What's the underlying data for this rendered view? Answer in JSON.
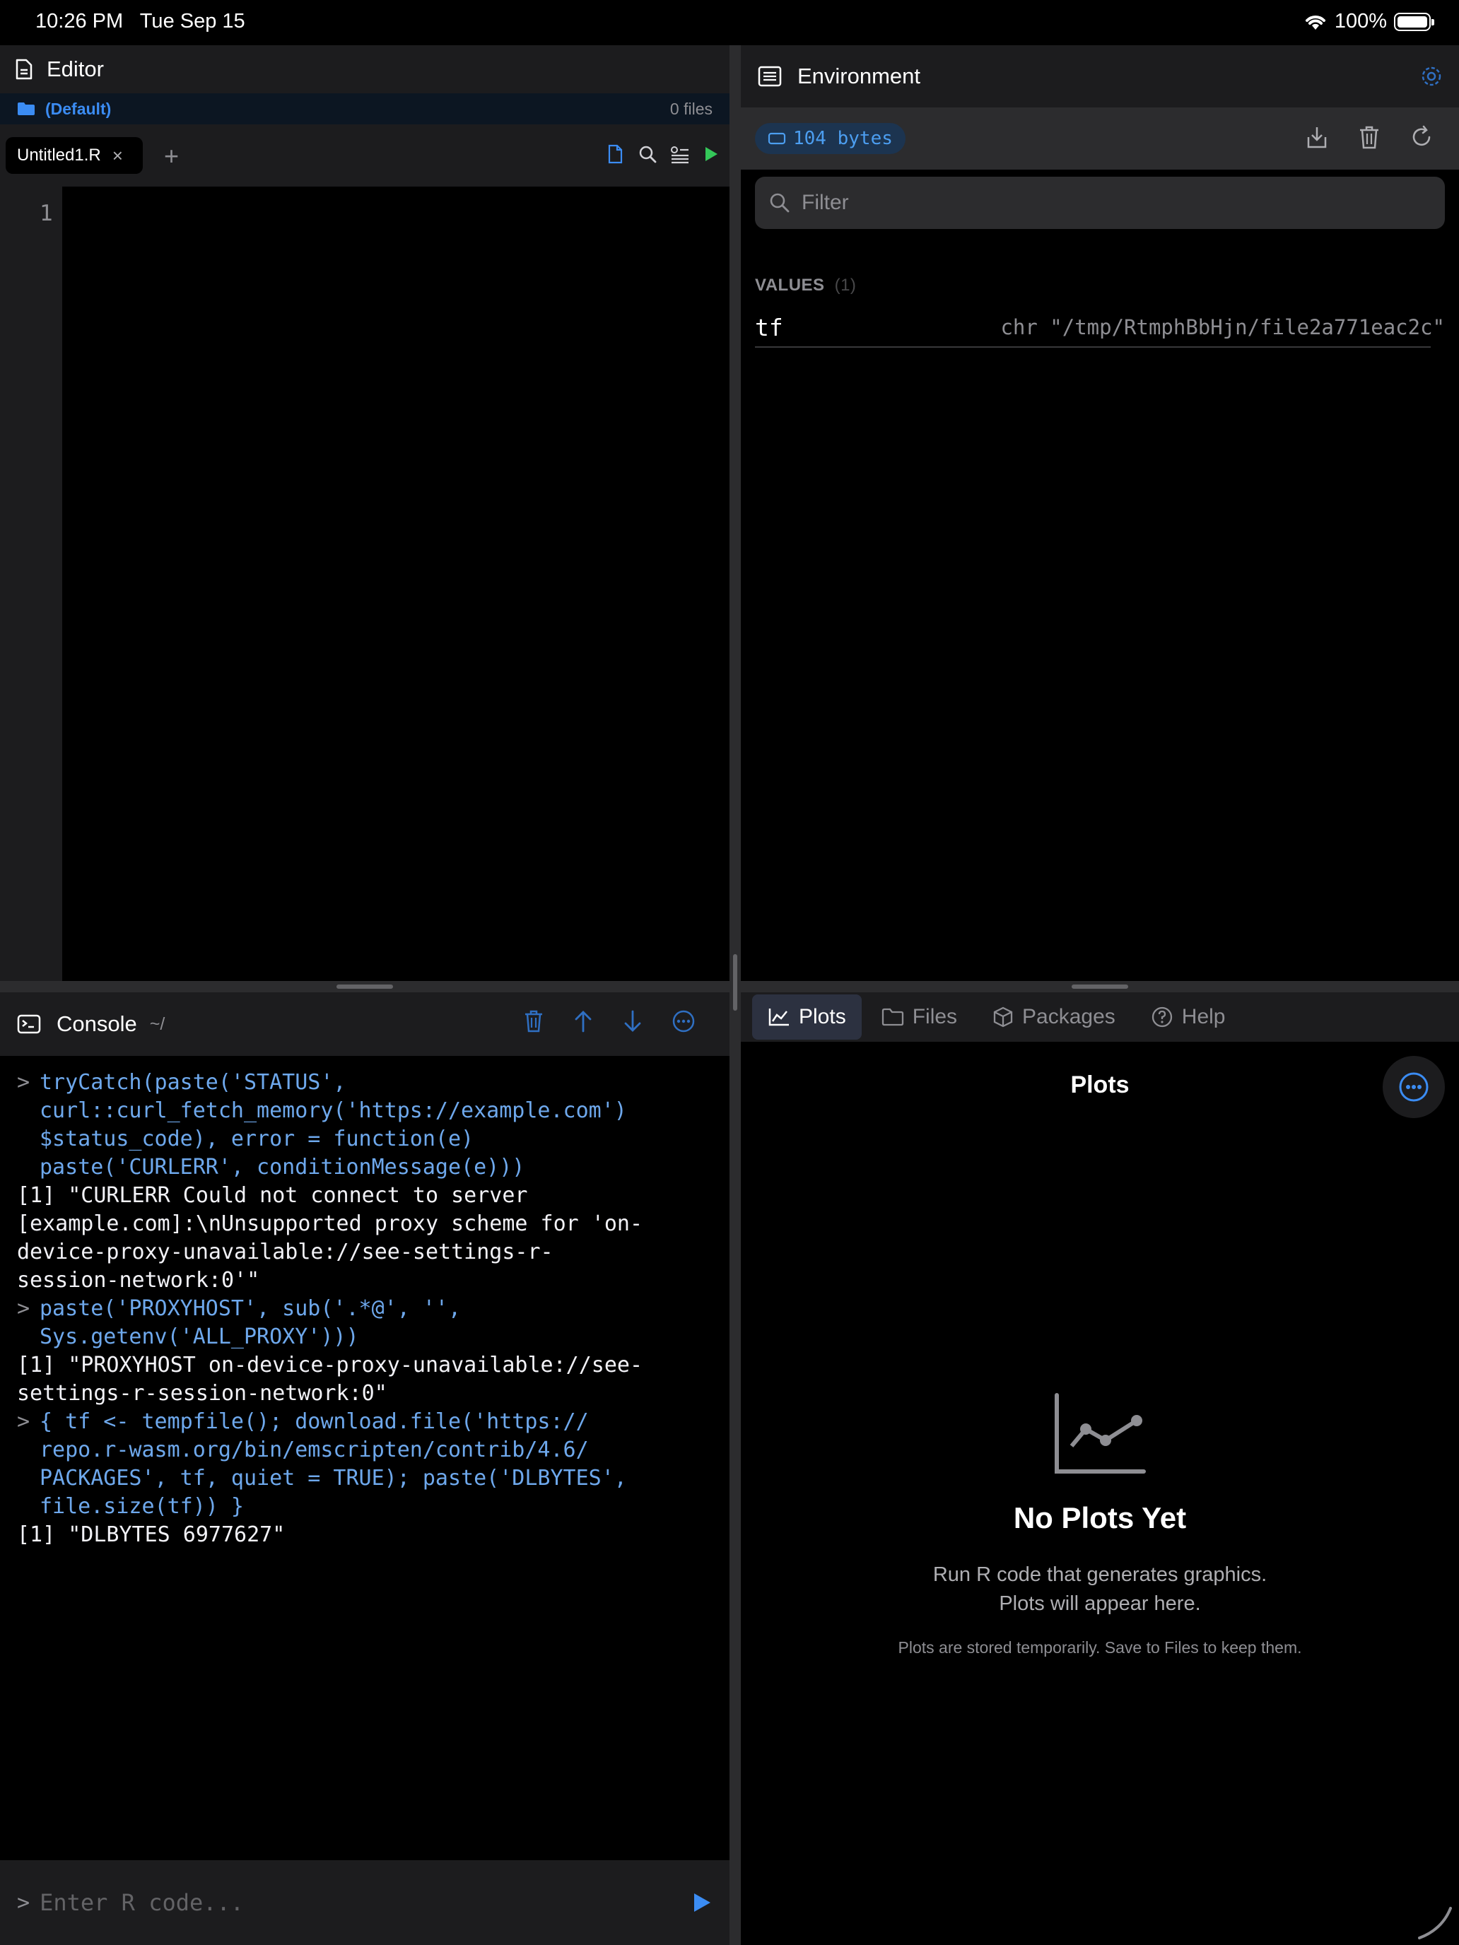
{
  "status": {
    "time": "10:26 PM",
    "date": "Tue Sep 15",
    "battery": "100%"
  },
  "editor": {
    "title": "Editor",
    "project": "(Default)",
    "file_count": "0 files",
    "tab": "Untitled1.R",
    "line_number": "1"
  },
  "console": {
    "title": "Console",
    "path": "~/",
    "entries": [
      {
        "type": "cmd",
        "text": "tryCatch(paste('STATUS',\ncurl::curl_fetch_memory('https://example.com')\n$status_code), error = function(e)\npaste('CURLERR', conditionMessage(e)))"
      },
      {
        "type": "res",
        "text": "[1] \"CURLERR Could not connect to server\n[example.com]:\\nUnsupported proxy scheme for 'on-\ndevice-proxy-unavailable://see-settings-r-\nsession-network:0'\""
      },
      {
        "type": "cmd",
        "text": "paste('PROXYHOST', sub('.*@', '',\nSys.getenv('ALL_PROXY')))"
      },
      {
        "type": "res",
        "text": "[1] \"PROXYHOST on-device-proxy-unavailable://see-\nsettings-r-session-network:0\""
      },
      {
        "type": "cmd",
        "text": "{ tf <- tempfile(); download.file('https://\nrepo.r-wasm.org/bin/emscripten/contrib/4.6/\nPACKAGES', tf, quiet = TRUE); paste('DLBYTES',\nfile.size(tf)) }"
      },
      {
        "type": "res",
        "text": "[1] \"DLBYTES 6977627\""
      }
    ],
    "prompt": ">",
    "input_placeholder": "Enter R code..."
  },
  "environment": {
    "title": "Environment",
    "memory": "104 bytes",
    "filter_placeholder": "Filter",
    "values_label": "VALUES",
    "values_count": "(1)",
    "variables": [
      {
        "name": "tf",
        "value": "chr \"/tmp/RtmphBbHjn/file2a771eac2c\""
      }
    ]
  },
  "panes": {
    "tabs": [
      "Plots",
      "Files",
      "Packages",
      "Help"
    ],
    "active": "Plots",
    "plots_title": "Plots",
    "empty_title": "No Plots Yet",
    "empty_line1": "Run R code that generates graphics.",
    "empty_line2": "Plots will appear here.",
    "empty_note": "Plots are stored temporarily. Save to Files to keep them."
  },
  "colors": {
    "accent": "#3b8cf3",
    "run_green": "#34c759",
    "code_blue": "#6ea8ec"
  }
}
